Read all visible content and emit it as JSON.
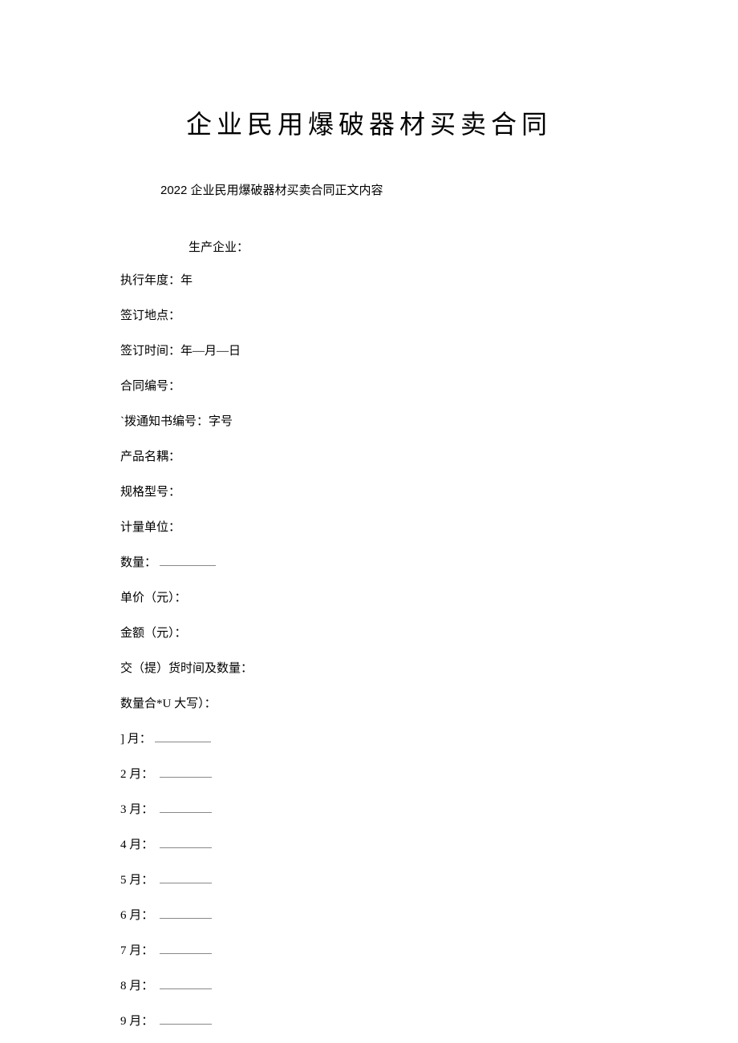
{
  "title": "企业民用爆破器材买卖合同",
  "subtitle": "2022 企业民用爆破器材买卖合同正文内容",
  "lines": {
    "producer": "生产企业：",
    "year": "执行年度：年",
    "location": "签订地点：",
    "signtime": "签订时间：年—月—日",
    "contractno": "合同编号：",
    "noticeno": "`拨通知书编号：字号",
    "product": "产品名耦：",
    "spec": "规格型号：",
    "unit": "计量单位：",
    "qty": "数量：",
    "price": "单价（元）：",
    "amount": "金额（元）：",
    "delivery": "交（提）货时间及数量：",
    "qtysum": "数量合*U 大写）：",
    "m1": "] 月：",
    "m2": "2 月：",
    "m3": "3 月：",
    "m4": "4 月：",
    "m5": "5 月：",
    "m6": "6 月：",
    "m7": "7 月：",
    "m8": "8 月：",
    "m9": "9 月："
  }
}
